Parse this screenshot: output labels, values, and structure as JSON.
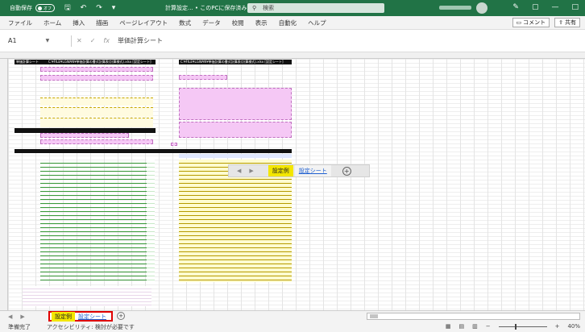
{
  "titlebar": {
    "autosave_label": "自動保存",
    "autosave_state": "オフ",
    "filename": "計算設定... • このPCに保存済み",
    "search_placeholder": "検索",
    "window_controls": [
      "✎",
      "▢",
      "—",
      "□"
    ]
  },
  "menu": {
    "items": [
      "ファイル",
      "ホーム",
      "挿入",
      "描画",
      "ページレイアウト",
      "数式",
      "データ",
      "校閲",
      "表示",
      "自動化",
      "ヘルプ"
    ],
    "comment_label": "コメント",
    "share_label": "共有"
  },
  "formula": {
    "cell_ref": "A1",
    "content": "単価計算シート"
  },
  "sheet": {
    "left_header": "単価計算シート",
    "left_title": "C:¥FILE¥LGWAN¥単価計算の書式計算表(計算様式).xlsx [設定シート]",
    "right_title": "C:¥FILE¥LGWAN¥単価計算の書式計算表(計算様式).xlsx [設定シート]"
  },
  "float_tabs": {
    "nav_prev": "◀",
    "nav_next": "▶",
    "active": "設定例",
    "other": "設定シート",
    "add": "+"
  },
  "tabs": {
    "active": "設定例",
    "other": "設定シート",
    "add": "+"
  },
  "status": {
    "ready": "準備完了",
    "accessibility": "アクセシビリティ: 検討が必要です",
    "zoom": "40%"
  },
  "colors": {
    "excel_green": "#217346",
    "highlight_yellow": "#f3e600",
    "tab_outline": "#e00000",
    "pink_fill": "#f5c8f5"
  }
}
